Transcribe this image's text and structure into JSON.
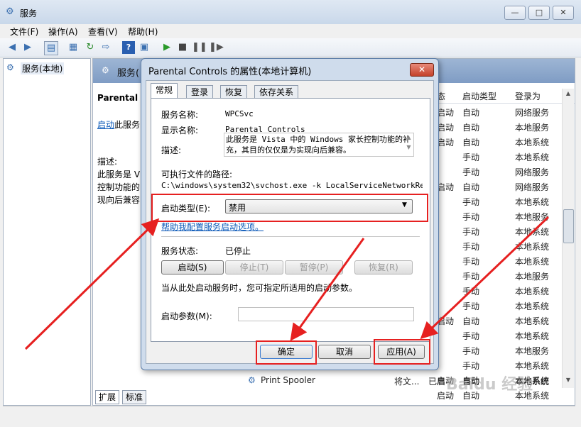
{
  "window": {
    "title": "服务",
    "minimize": "—",
    "maximize": "□",
    "close": "✕"
  },
  "menu": [
    "文件(F)",
    "操作(A)",
    "查看(V)",
    "帮助(H)"
  ],
  "tree": {
    "item": "服务(本地)"
  },
  "pane": {
    "header": "服务(",
    "service_name": "Parental C",
    "start_link": "启动",
    "start_suffix": "此服务",
    "desc_label": "描述:",
    "desc_lines": [
      "此服务是 V",
      "控制功能的",
      "现向后兼容"
    ]
  },
  "columns": {
    "status": "态",
    "startup": "启动类型",
    "logon": "登录为"
  },
  "rows": [
    {
      "s": "启动",
      "t": "自动",
      "l": "网络服务"
    },
    {
      "s": "启动",
      "t": "自动",
      "l": "本地服务"
    },
    {
      "s": "启动",
      "t": "自动",
      "l": "本地系统"
    },
    {
      "s": "",
      "t": "手动",
      "l": "本地系统"
    },
    {
      "s": "",
      "t": "手动",
      "l": "网络服务"
    },
    {
      "s": "启动",
      "t": "自动",
      "l": "网络服务"
    },
    {
      "s": "",
      "t": "手动",
      "l": "本地系统"
    },
    {
      "s": "",
      "t": "手动",
      "l": "本地服务"
    },
    {
      "s": "",
      "t": "手动",
      "l": "本地系统"
    },
    {
      "s": "",
      "t": "手动",
      "l": "本地系统"
    },
    {
      "s": "",
      "t": "手动",
      "l": "本地系统"
    },
    {
      "s": "",
      "t": "手动",
      "l": "本地服务"
    },
    {
      "s": "",
      "t": "手动",
      "l": "本地系统"
    },
    {
      "s": "",
      "t": "手动",
      "l": "本地系统"
    },
    {
      "s": "启动",
      "t": "自动",
      "l": "本地系统"
    },
    {
      "s": "",
      "t": "手动",
      "l": "本地系统"
    },
    {
      "s": "",
      "t": "手动",
      "l": "本地服务"
    },
    {
      "s": "",
      "t": "手动",
      "l": "本地系统"
    },
    {
      "s": "启动",
      "t": "自动",
      "l": "本地系统"
    },
    {
      "s": "启动",
      "t": "自动",
      "l": "本地系统"
    }
  ],
  "print_row": {
    "name": "Print Spooler",
    "desc": "将文...",
    "status": "已启",
    "startup": "自动",
    "logon": "本地系统"
  },
  "bottom_tabs": [
    "扩展",
    "标准"
  ],
  "dialog": {
    "title": "Parental Controls 的属性(本地计算机)",
    "tabs": [
      "常规",
      "登录",
      "恢复",
      "依存关系"
    ],
    "service_name_label": "服务名称:",
    "service_name": "WPCSvc",
    "display_name_label": "显示名称:",
    "display_name": "Parental Controls",
    "description_label": "描述:",
    "description": "此服务是 Vista 中的 Windows 家长控制功能的补充，其目的仅仅是为实现向后兼容。",
    "path_label": "可执行文件的路径:",
    "path": "C:\\windows\\system32\\svchost.exe -k LocalServiceNetworkRestri",
    "startup_type_label": "启动类型(E):",
    "startup_type": "禁用",
    "help_link": "帮助我配置服务启动选项。",
    "status_label": "服务状态:",
    "status_value": "已停止",
    "btn_start": "启动(S)",
    "btn_stop": "停止(T)",
    "btn_pause": "暂停(P)",
    "btn_resume": "恢复(R)",
    "hint": "当从此处启动服务时，您可指定所适用的启动参数。",
    "params_label": "启动参数(M):",
    "params_value": "",
    "ok": "确定",
    "cancel": "取消",
    "apply": "应用(A)"
  },
  "watermark": "Baidu 经验",
  "colors": {
    "annotation": "#e62020",
    "link": "#0a58b8"
  }
}
